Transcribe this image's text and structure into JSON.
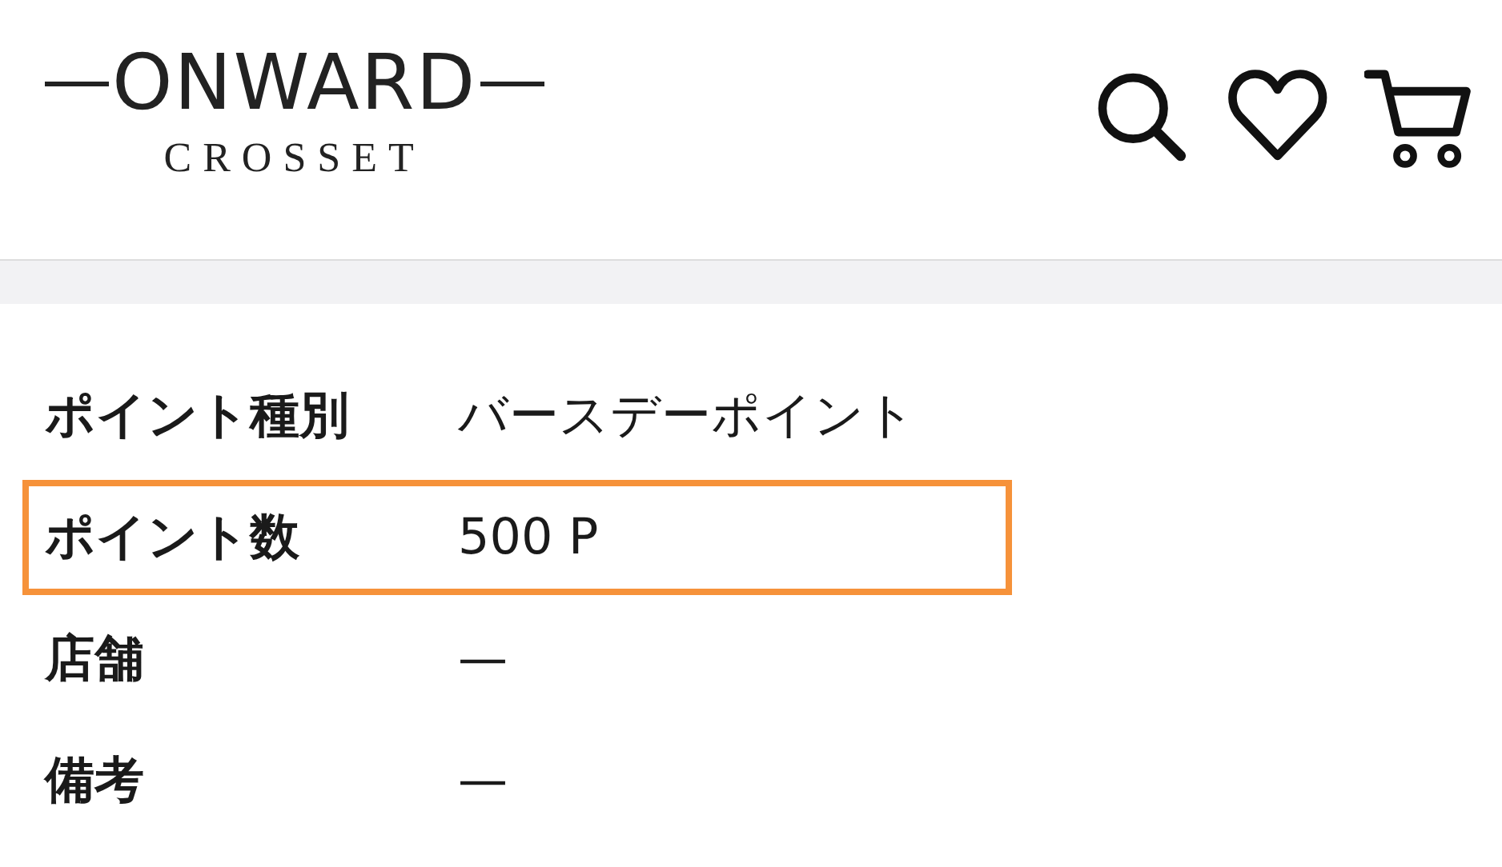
{
  "logo": {
    "brand": "ONWARD",
    "sub": "CROSSET"
  },
  "header_icons": [
    {
      "kind": "search"
    },
    {
      "kind": "heart"
    },
    {
      "kind": "cart"
    }
  ],
  "rows": [
    {
      "label": "ポイント種別",
      "value": "バースデーポイント",
      "highlighted": false
    },
    {
      "label": "ポイント数",
      "value": "500 P",
      "highlighted": true
    },
    {
      "label": "店舗",
      "value": "—",
      "highlighted": false
    },
    {
      "label": "備考",
      "value": "—",
      "highlighted": false
    }
  ]
}
